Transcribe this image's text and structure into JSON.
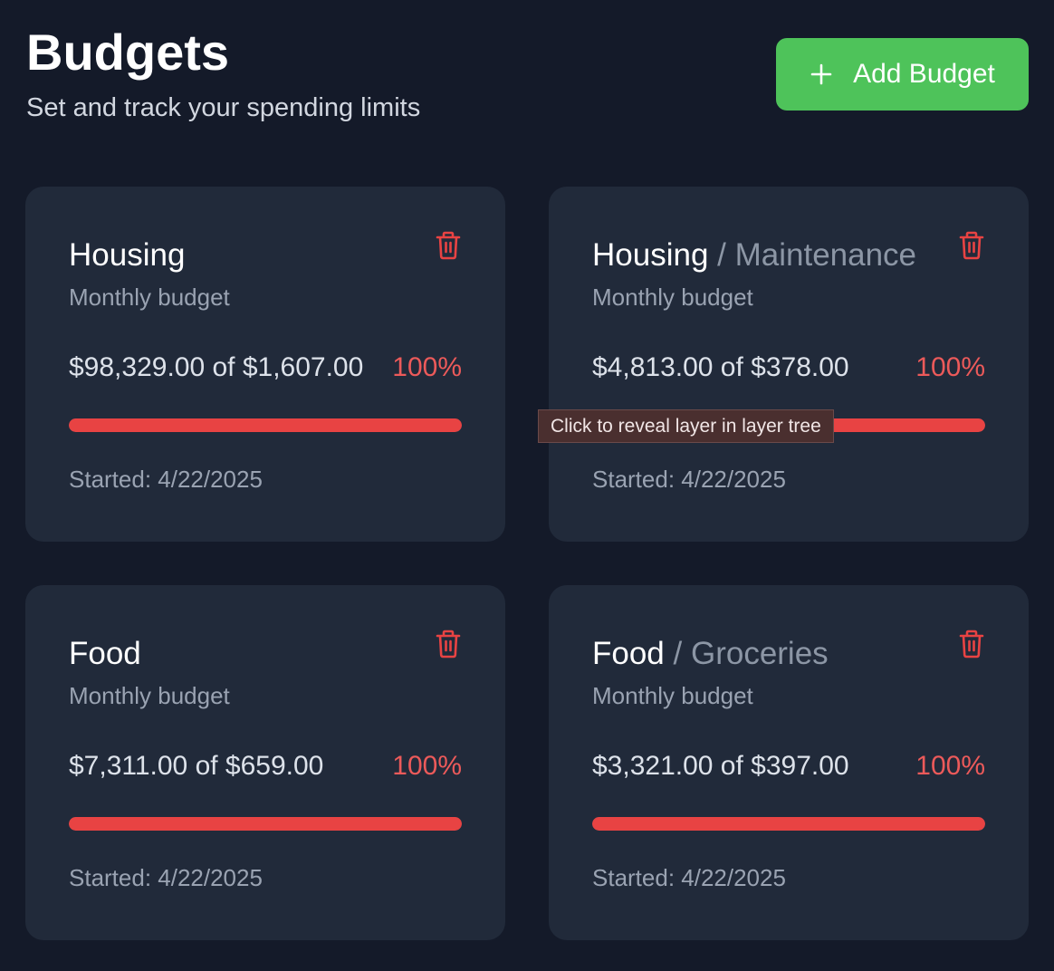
{
  "header": {
    "title": "Budgets",
    "subtitle": "Set and track your spending limits",
    "add_button_label": "Add Budget"
  },
  "budgets": [
    {
      "category": "Housing",
      "subcategory": "",
      "separator": "",
      "period": "Monthly budget",
      "amount_text": "$98,329.00 of $1,607.00",
      "percent_text": "100%",
      "progress_fraction": 1.0,
      "started_text": "Started: 4/22/2025"
    },
    {
      "category": "Housing",
      "subcategory": "Maintenance",
      "separator": " / ",
      "period": "Monthly budget",
      "amount_text": "$4,813.00 of $378.00",
      "percent_text": "100%",
      "progress_fraction": 1.0,
      "started_text": "Started: 4/22/2025"
    },
    {
      "category": "Food",
      "subcategory": "",
      "separator": "",
      "period": "Monthly budget",
      "amount_text": "$7,311.00 of $659.00",
      "percent_text": "100%",
      "progress_fraction": 1.0,
      "started_text": "Started: 4/22/2025"
    },
    {
      "category": "Food",
      "subcategory": "Groceries",
      "separator": " / ",
      "period": "Monthly budget",
      "amount_text": "$3,321.00 of $397.00",
      "percent_text": "100%",
      "progress_fraction": 1.0,
      "started_text": "Started: 4/22/2025"
    }
  ],
  "tooltip": {
    "text": "Click to reveal layer in layer tree"
  },
  "icons": {
    "add": "plus-icon",
    "delete": "trash-icon"
  },
  "colors": {
    "background": "#141a29",
    "card": "#212a3a",
    "accent_button": "#4ec35a",
    "over_budget": "#e84343",
    "percent_text": "#ec5a5a"
  }
}
